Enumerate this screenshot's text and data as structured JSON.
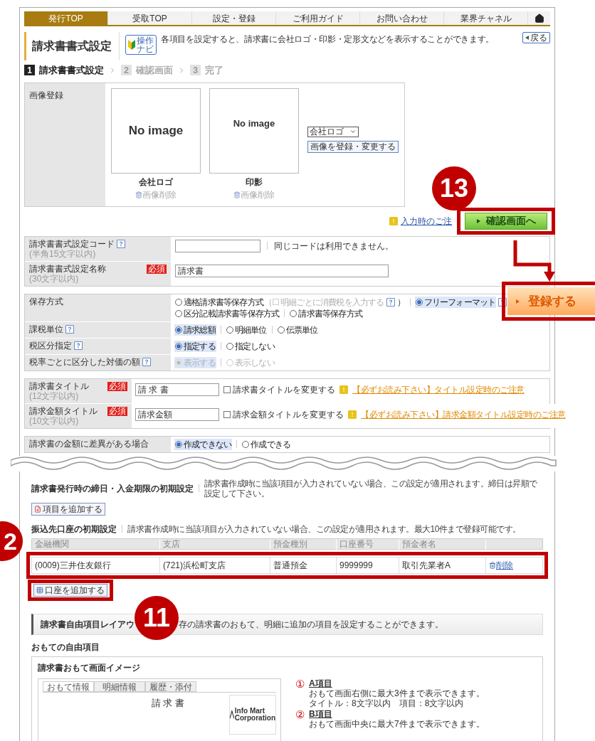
{
  "nav": {
    "tabs": [
      {
        "label": "発行TOP",
        "selected": true
      },
      {
        "label": "受取TOP",
        "selected": false
      },
      {
        "label": "設定・登録",
        "selected": false
      },
      {
        "label": "ご利用ガイド",
        "selected": false
      },
      {
        "label": "お問い合わせ",
        "selected": false
      },
      {
        "label": "業界チャネル",
        "selected": false
      }
    ]
  },
  "header": {
    "title": "請求書書式設定",
    "nav_button": [
      "操作",
      "ナビ"
    ],
    "description": "各項目を設定すると、請求書に会社ロゴ・印影・定形文などを表示することができます。",
    "back_button": "戻る"
  },
  "steps": [
    {
      "number": "1",
      "label": "請求書書式設定",
      "selected": true
    },
    {
      "number": "2",
      "label": "確認画面",
      "selected": false
    },
    {
      "number": "3",
      "label": "完了",
      "selected": false
    }
  ],
  "image_registration": {
    "label": "画像登録",
    "images": [
      {
        "placeholder": "No image",
        "caption": "会社ロゴ",
        "delete_link": "画像削除"
      },
      {
        "placeholder": "No image",
        "caption": "印影",
        "delete_link": "画像削除"
      }
    ],
    "select_value": "会社ロゴ",
    "register_button": "画像を登録・変更する"
  },
  "notice_link": "入力時のご注",
  "confirm_button": "確認画面へ",
  "form_groups": [
    {
      "rows": [
        {
          "kind": "text",
          "label": "請求書書式設定コード",
          "help": true,
          "sublabel": "(半角15文字以内)",
          "note": "同じコードは利用できません。"
        },
        {
          "kind": "text",
          "label": "請求書書式設定名称",
          "sublabel": "(30文字以内)",
          "required": "必須",
          "value": "請求書"
        }
      ]
    },
    {
      "rows": [
        {
          "kind": "radio",
          "label": "保存方式",
          "lines": [
            [
              {
                "label": "適格請求書等保存方式",
                "selected": false,
                "disabled": false,
                "sub_option": {
                  "open": "（",
                  "label": "明細ごとに消費税を入力する",
                  "checked": false,
                  "help": true,
                  "close": "）"
                }
              },
              {
                "label": "フリーフォーマット",
                "selected": true,
                "disabled": false,
                "help": true
              }
            ],
            [
              {
                "label": "区分記載請求書等保存方式",
                "selected": false,
                "disabled": false
              },
              {
                "label": "請求書等保存方式",
                "selected": false,
                "disabled": false
              }
            ]
          ]
        },
        {
          "kind": "radio",
          "label": "課税単位",
          "help": true,
          "lines": [
            [
              {
                "label": "請求総額",
                "selected": true,
                "disabled": false
              },
              {
                "label": "明細単位",
                "selected": false,
                "disabled": false
              },
              {
                "label": "伝票単位",
                "selected": false,
                "disabled": false
              }
            ]
          ]
        },
        {
          "kind": "radio",
          "label": "税区分指定",
          "help": true,
          "lines": [
            [
              {
                "label": "指定する",
                "selected": true,
                "disabled": false
              },
              {
                "label": "指定しない",
                "selected": false,
                "disabled": false
              }
            ]
          ]
        },
        {
          "kind": "radio",
          "label": "税率ごとに区分した対価の額",
          "help": true,
          "lines": [
            [
              {
                "label": "表示する",
                "selected": true,
                "disabled": true
              },
              {
                "label": "表示しない",
                "selected": false,
                "disabled": true
              }
            ]
          ]
        }
      ]
    },
    {
      "rows": [
        {
          "kind": "title",
          "label": "請求書タイトル",
          "sublabel": "(12文字以内)",
          "required": "必須",
          "value": "請 求 書",
          "checkbox": {
            "label": "請求書タイトルを変更する",
            "checked": false
          },
          "warning_link": "【必ずお読み下さい】タイトル設定時のご注意"
        },
        {
          "kind": "title",
          "label": "請求金額タイトル",
          "sublabel": "(10文字以内)",
          "required": "必須",
          "value": "請求金額",
          "checkbox": {
            "label": "請求金額タイトルを変更する",
            "checked": false
          },
          "warning_link": "【必ずお読み下さい】請求金額タイトル設定時のご注意"
        }
      ]
    },
    {
      "rows": [
        {
          "kind": "radio",
          "label": "請求書の金額に差異がある場合",
          "lines": [
            [
              {
                "label": "作成できない",
                "selected": true,
                "disabled": false
              },
              {
                "label": "作成できる",
                "selected": false,
                "disabled": false
              }
            ]
          ]
        }
      ]
    }
  ],
  "deadline_section": {
    "title": "請求書発行時の締日・入金期限の初期設定",
    "note": "請求書作成時に当該項目が入力されていない場合、この設定が適用されます。締日は昇順で設定して下さい。",
    "add_button": "項目を追加する"
  },
  "bank_section": {
    "title": "振込先口座の初期設定",
    "note": "請求書作成時に当該項目が入力されていない場合、この設定が適用されます。最大10件まで登録可能です。",
    "columns": [
      "金融機関",
      "支店",
      "預金種別",
      "口座番号",
      "預金者名"
    ],
    "rows": [
      {
        "cells": [
          "(0009)三井住友銀行",
          "(721)浜松町支店",
          "普通預金",
          "9999999",
          "取引先業者A"
        ],
        "delete_link": "削除"
      }
    ],
    "add_button": "口座を追加する"
  },
  "free_layout": {
    "heading": "請求書自由項目レイアウ",
    "description": "存の請求書のおもて、明細に追加の項目を設定することができます。",
    "subheading": "おもての自由項目",
    "card_title": "請求書おもて画面イメージ",
    "preview": {
      "tabs": [
        "おもて情報",
        "明細情報",
        "履歴・添付"
      ],
      "title": "請 求 書",
      "logo": [
        "Info Mart",
        "Corporation"
      ]
    },
    "items": [
      {
        "number": "①",
        "title": "A項目",
        "lines": [
          "おもて画面右側に最大3件まで表示できます。",
          "タイトル：8文字以内　項目：8文字以内"
        ]
      },
      {
        "number": "②",
        "title": "B項目",
        "lines": [
          "おもて画面中央に最大7件まで表示できます。"
        ]
      }
    ]
  },
  "callouts": {
    "markers": [
      "13",
      "2",
      "11"
    ],
    "register_button": "登録する"
  }
}
